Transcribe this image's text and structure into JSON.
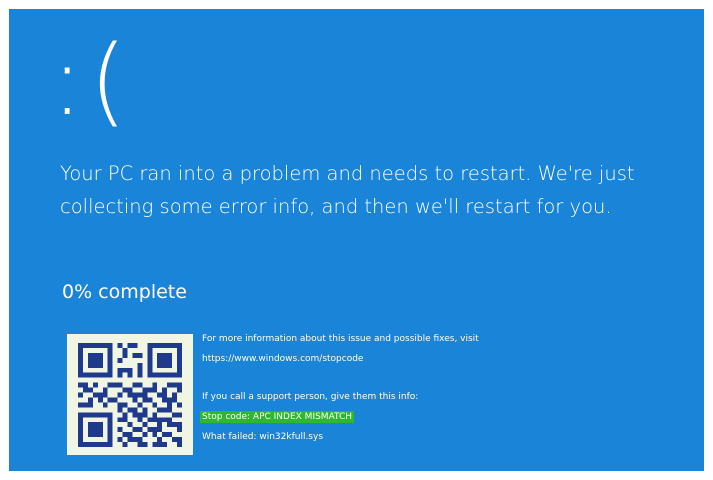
{
  "screen": {
    "background": "#1a84d9",
    "sad_face": ":(",
    "headline": "Your PC ran into a problem and needs to restart. We're just collecting some error info, and then we'll restart for you.",
    "progress": "0% complete",
    "qr_code_icon": "qr-code",
    "info": {
      "more_info": "For more information about this issue and possible fixes, visit",
      "url": "https://www.windows.com/stopcode",
      "support_text": "If you call a support person, give them this info:",
      "stop_code": "Stop code: APC INDEX MISMATCH",
      "what_failed": "What failed: win32kfull.sys"
    },
    "highlight_color": "#2eb82a"
  }
}
